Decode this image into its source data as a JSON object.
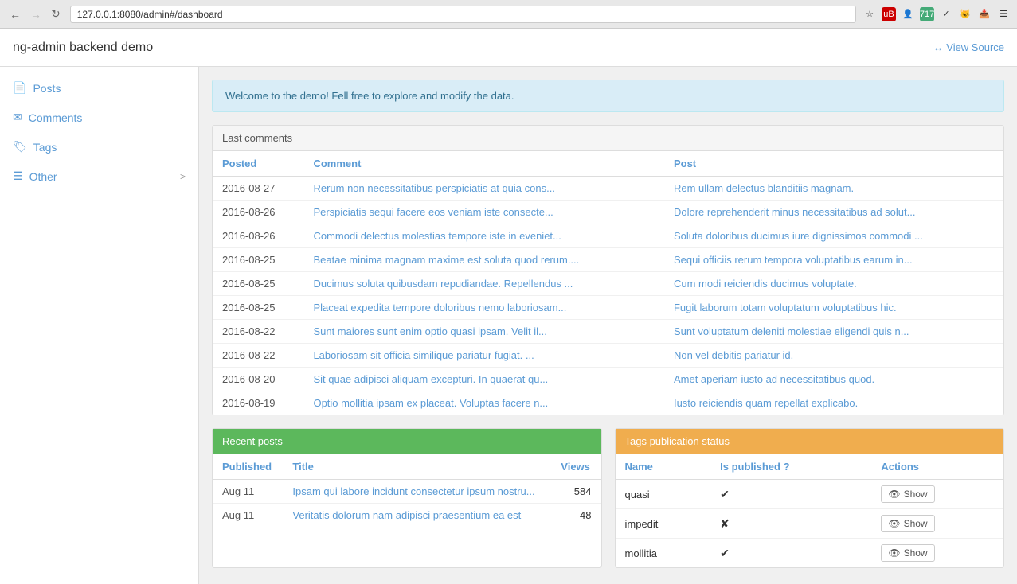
{
  "browser": {
    "url": "127.0.0.1:8080/admin#/dashboard",
    "back_disabled": false,
    "forward_disabled": true
  },
  "app": {
    "title": "ng-admin backend demo",
    "view_source_label": "↔ View Source"
  },
  "sidebar": {
    "items": [
      {
        "id": "posts",
        "label": "Posts",
        "icon": "📄",
        "has_chevron": false
      },
      {
        "id": "comments",
        "label": "Comments",
        "icon": "✉",
        "has_chevron": false
      },
      {
        "id": "tags",
        "label": "Tags",
        "icon": "🏷",
        "has_chevron": false
      },
      {
        "id": "other",
        "label": "Other",
        "icon": "☰",
        "has_chevron": true
      }
    ]
  },
  "welcome": {
    "message": "Welcome to the demo! Fell free to explore and modify the data."
  },
  "last_comments": {
    "panel_title": "Last comments",
    "columns": [
      "Posted",
      "Comment",
      "Post"
    ],
    "rows": [
      {
        "date": "2016-08-27",
        "comment": "Rerum non necessitatibus perspiciatis at quia cons...",
        "post": "Rem ullam delectus blanditiis magnam."
      },
      {
        "date": "2016-08-26",
        "comment": "Perspiciatis sequi facere eos veniam iste consecte...",
        "post": "Dolore reprehenderit minus necessitatibus ad solut..."
      },
      {
        "date": "2016-08-26",
        "comment": "Commodi delectus molestias tempore iste in eveniet...",
        "post": "Soluta doloribus ducimus iure dignissimos commodi ..."
      },
      {
        "date": "2016-08-25",
        "comment": "Beatae minima magnam maxime est soluta quod rerum....",
        "post": "Sequi officiis rerum tempora voluptatibus earum in..."
      },
      {
        "date": "2016-08-25",
        "comment": "Ducimus soluta quibusdam repudiandae. Repellendus ...",
        "post": "Cum modi reiciendis ducimus voluptate."
      },
      {
        "date": "2016-08-25",
        "comment": "Placeat expedita tempore doloribus nemo laboriosam...",
        "post": "Fugit laborum totam voluptatum voluptatibus hic."
      },
      {
        "date": "2016-08-22",
        "comment": "Sunt maiores sunt enim optio quasi ipsam. Velit il...",
        "post": "Sunt voluptatum deleniti molestiae eligendi quis n..."
      },
      {
        "date": "2016-08-22",
        "comment": "Laboriosam sit officia similique pariatur fugiat. ...",
        "post": "Non vel debitis pariatur id."
      },
      {
        "date": "2016-08-20",
        "comment": "Sit quae adipisci aliquam excepturi. In quaerat qu...",
        "post": "Amet aperiam iusto ad necessitatibus quod."
      },
      {
        "date": "2016-08-19",
        "comment": "Optio mollitia ipsam ex placeat. Voluptas facere n...",
        "post": "Iusto reiciendis quam repellat explicabo."
      }
    ]
  },
  "recent_posts": {
    "panel_title": "Recent posts",
    "columns": [
      "Published",
      "Title",
      "Views"
    ],
    "rows": [
      {
        "published": "Aug 11",
        "title": "Ipsam qui labore incidunt consectetur ipsum nostru...",
        "views": "584"
      },
      {
        "published": "Aug 11",
        "title": "Veritatis dolorum nam adipisci praesentium ea est",
        "views": "48"
      }
    ]
  },
  "tags_status": {
    "panel_title": "Tags publication status",
    "columns": [
      "Name",
      "Is published ?",
      "Actions"
    ],
    "rows": [
      {
        "name": "quasi",
        "is_published": true,
        "show_label": "Show"
      },
      {
        "name": "impedit",
        "is_published": false,
        "show_label": "Show"
      },
      {
        "name": "mollitia",
        "is_published": true,
        "show_label": "Show"
      }
    ]
  }
}
